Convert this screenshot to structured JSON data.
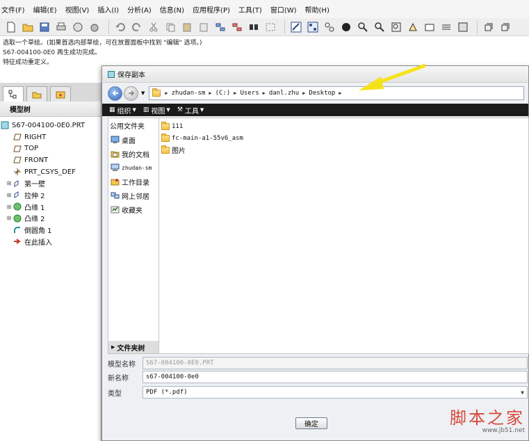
{
  "menubar": {
    "items": [
      "文件(F)",
      "编辑(E)",
      "视图(V)",
      "插入(I)",
      "分析(A)",
      "信息(N)",
      "应用程序(P)",
      "工具(T)",
      "窗口(W)",
      "帮助(H)"
    ]
  },
  "messages": [
    "选取一个草绘。(如果首选内部草绘，可在放置面板中找到 \"编辑\" 选项。)",
    "S67-004100-0E0 再生成功完成。",
    "特征成功重定义。"
  ],
  "model_tree": {
    "header": "模型树",
    "items": [
      {
        "label": "S67-004100-0E0.PRT",
        "icon": "part-icon"
      },
      {
        "label": "RIGHT",
        "icon": "datum-plane-icon"
      },
      {
        "label": "TOP",
        "icon": "datum-plane-icon"
      },
      {
        "label": "FRONT",
        "icon": "datum-plane-icon"
      },
      {
        "label": "PRT_CSYS_DEF",
        "icon": "csys-icon"
      },
      {
        "label": "第一壁",
        "icon": "feature-icon"
      },
      {
        "label": "拉伸 2",
        "icon": "feature-icon"
      },
      {
        "label": "凸缘 1",
        "icon": "flange-icon"
      },
      {
        "label": "凸缘 2",
        "icon": "flange-icon"
      },
      {
        "label": "倒圆角 1",
        "icon": "round-icon"
      },
      {
        "label": "在此插入",
        "icon": "insert-arrow-icon"
      }
    ]
  },
  "dialog": {
    "title": "保存副本",
    "address": [
      "zhudan-sm",
      "(C:)",
      "Users",
      "danl.zhu",
      "Desktop"
    ],
    "commands": [
      "组织",
      "视图",
      "工具"
    ],
    "favorites_header": "公用文件夹",
    "favorites": [
      {
        "label": "桌面",
        "icon": "desktop-icon"
      },
      {
        "label": "我的文档",
        "icon": "documents-icon"
      },
      {
        "label": "zhudan-sm",
        "icon": "computer-icon"
      },
      {
        "label": "工作目录",
        "icon": "working-dir-icon"
      },
      {
        "label": "网上邻居",
        "icon": "network-icon"
      },
      {
        "label": "收藏夹",
        "icon": "favorites-icon"
      }
    ],
    "folder_tree_label": "文件夹树",
    "files": [
      "111",
      "fc-main-a1-55v6_asm",
      "图片"
    ],
    "model_name_label": "模型名称",
    "model_name_value": "S67-004100-0E0.PRT",
    "new_name_label": "新名称",
    "new_name_value": "s67-004100-0e0",
    "type_label": "类型",
    "type_value": "PDF (*.pdf)",
    "ok_label": "确定"
  },
  "colors": {
    "command_bar": "#1b1b1b",
    "annotation_arrow": "#f5e31a",
    "watermark": "#d44a3a"
  },
  "watermark": {
    "main": "脚本之家",
    "url": "www.jb51.net"
  }
}
